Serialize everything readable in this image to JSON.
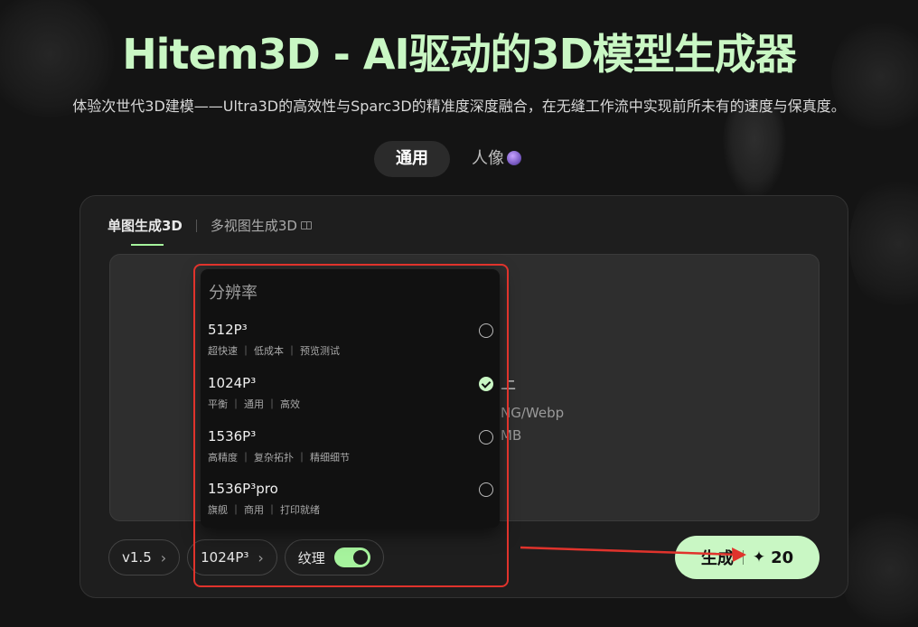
{
  "header": {
    "title": "Hitem3D - AI驱动的3D模型生成器",
    "subtitle": "体验次世代3D建模——Ultra3D的高效性与Sparc3D的精准度深度融合，在无缝工作流中实现前所未有的速度与保真度。"
  },
  "mode_tabs": [
    {
      "label": "通用",
      "active": true
    },
    {
      "label": "人像",
      "active": false
    }
  ],
  "sub_tabs": [
    {
      "label": "单图生成3D",
      "active": true
    },
    {
      "label": "多视图生成3D",
      "active": false
    }
  ],
  "upload": {
    "partial_line1": "上",
    "partial_line2": "NG/Webp",
    "partial_line3": "MB"
  },
  "controls": {
    "version_label": "v1.5",
    "resolution_label": "1024P³",
    "texture_label": "纹理",
    "texture_enabled": true
  },
  "generate": {
    "label": "生成",
    "sparkle": "✦",
    "cost": "20"
  },
  "resolution_dropdown": {
    "title": "分辨率",
    "options": [
      {
        "name": "512P³",
        "desc": "超快速 ｜ 低成本 ｜ 预览测试",
        "selected": false
      },
      {
        "name": "1024P³",
        "desc": "平衡 ｜ 通用 ｜ 高效",
        "selected": true
      },
      {
        "name": "1536P³",
        "desc": "高精度 ｜ 复杂拓扑 ｜ 精细细节",
        "selected": false
      },
      {
        "name": "1536P³pro",
        "desc": "旗舰 ｜ 商用 ｜ 打印就绪",
        "selected": false
      }
    ]
  },
  "colors": {
    "accent": "#c9f7c4",
    "toggle": "#a6f39d",
    "annotation": "#e0332c"
  }
}
